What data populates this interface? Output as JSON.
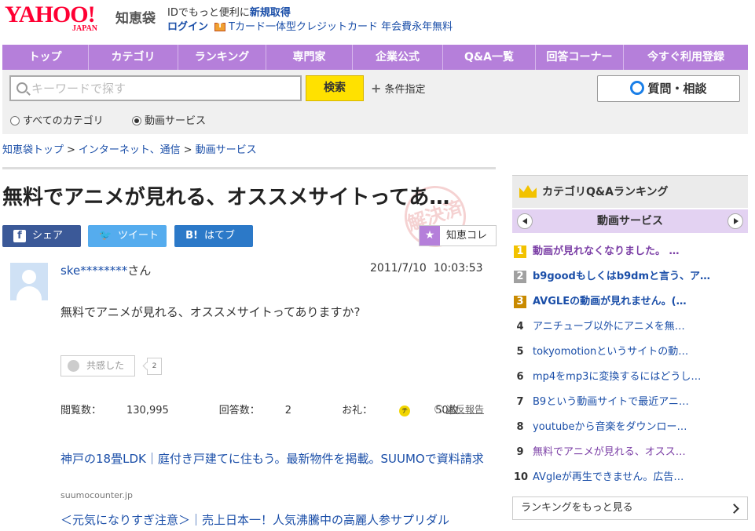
{
  "header": {
    "logo_text": "YAHOO!",
    "logo_sub": "JAPAN",
    "service_name": "知恵袋",
    "promo_prefix": "IDでもっと便利に",
    "promo_link": "新規取得",
    "login": "ログイン",
    "card_promo": "Tカード一体型クレジットカード 年会費永年無料"
  },
  "nav": {
    "items": [
      {
        "label": "トップ"
      },
      {
        "label": "カテゴリ"
      },
      {
        "label": "ランキング"
      },
      {
        "label": "専門家"
      },
      {
        "label": "企業公式"
      },
      {
        "label": "Q&A一覧"
      },
      {
        "label": "回答コーナー"
      },
      {
        "label": "今すぐ利用登録"
      }
    ]
  },
  "search": {
    "placeholder": "キーワードで探す",
    "button": "検索",
    "condition": "条件指定",
    "ask_button": "質問・相談",
    "scope_all": "すべてのカテゴリ",
    "scope_current": "動画サービス",
    "selected_scope": "動画サービス"
  },
  "breadcrumb": {
    "items": [
      "知恵袋トップ",
      "インターネット、通信",
      "動画サービス"
    ],
    "separator": ">"
  },
  "question": {
    "title": "無料でアニメが見れる、オススメサイトってあ…",
    "stamp": "解決済",
    "share": {
      "facebook": "シェア",
      "twitter": "ツイート",
      "hatena": "はてブ"
    },
    "chiekore": "知恵コレ",
    "user": "ske********",
    "user_suffix": "さん",
    "date": "2011/7/10",
    "time": "10:03:53",
    "body": "無料でアニメが見れる、オススメサイトってありますか?",
    "empathy_label": "共感した",
    "empathy_count": "2",
    "views_label": "閲覧数：",
    "views": "130,995",
    "answers_label": "回答数：",
    "answers": "2",
    "reward_label": "お礼：",
    "reward_coin": "チ",
    "reward": "50枚",
    "report": "違反報告"
  },
  "ads": [
    {
      "title": "神戸の18畳LDK｜庭付き戸建てに住もう。最新物件を掲載。SUUMOで資料請求",
      "domain": "suumocounter.jp"
    },
    {
      "title": "＜元気になりすぎ注意＞｜売上日本一！人気沸騰中の高麗人参サプリダル"
    }
  ],
  "sidebar": {
    "title": "カテゴリQ&Aランキング",
    "category": "動画サービス",
    "ranking": [
      {
        "rank": "1",
        "text": "動画が見れなくなりました。 …",
        "style": "visited"
      },
      {
        "rank": "2",
        "text": "b9goodもしくはb9dmと言う、ア…",
        "style": "bold"
      },
      {
        "rank": "3",
        "text": "AVGLEの動画が見れません。(…",
        "style": "bold"
      },
      {
        "rank": "4",
        "text": "アニチューブ以外にアニメを無…",
        "style": "normal"
      },
      {
        "rank": "5",
        "text": "tokyomotionというサイトの動…",
        "style": "normal"
      },
      {
        "rank": "6",
        "text": "mp4をmp3に変換するにはどうし…",
        "style": "normal"
      },
      {
        "rank": "7",
        "text": "B9という動画サイトで最近アニ…",
        "style": "normal"
      },
      {
        "rank": "8",
        "text": "youtubeから音楽をダウンロー…",
        "style": "normal"
      },
      {
        "rank": "9",
        "text": "無料でアニメが見れる、オスス…",
        "style": "visited"
      },
      {
        "rank": "10",
        "text": "AVgleが再生できません。広告…",
        "style": "normal"
      }
    ],
    "more": "ランキングをもっと見る",
    "medal_colors": [
      "#f2c200",
      "#a0a0a0",
      "#c98a00"
    ]
  }
}
